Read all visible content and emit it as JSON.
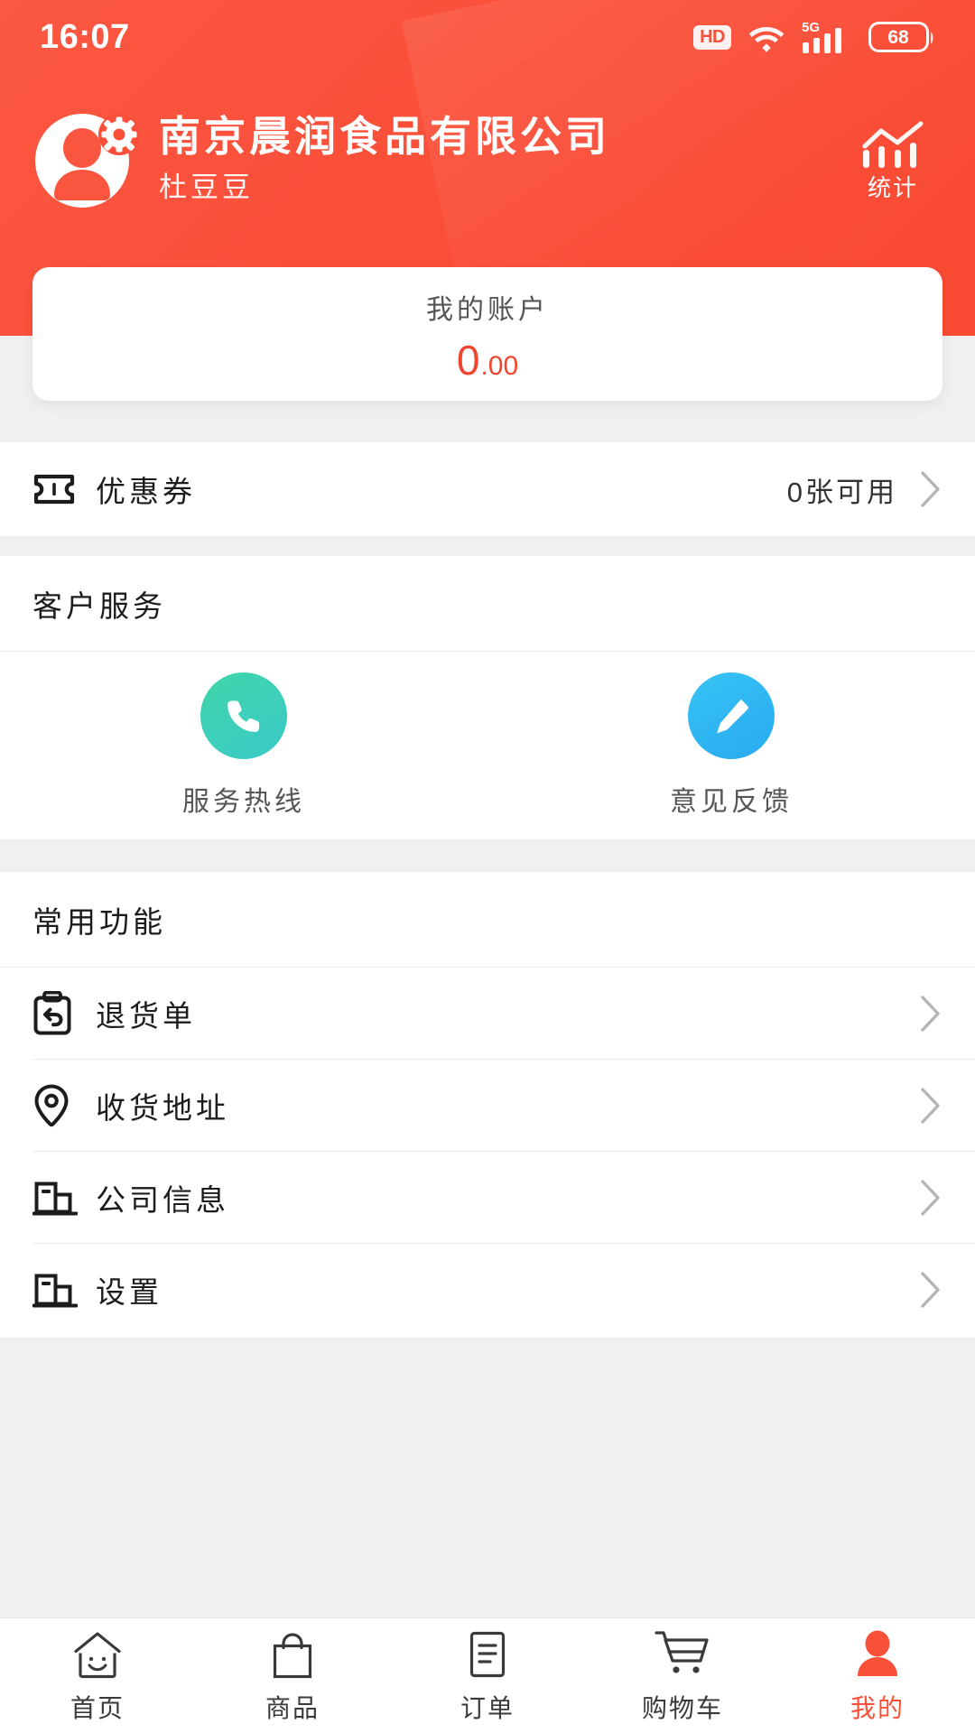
{
  "theme": {
    "brand": "#fa4f39",
    "accent": "#f0462f",
    "page_bg": "#f0f0f0",
    "hotline_icon_color": "#3ed6a8",
    "feedback_icon_color": "#32bcf3",
    "tab_active_color": "#f9503a"
  },
  "status_bar": {
    "time": "16:07",
    "hd_label": "HD",
    "network_label": "5G",
    "battery_level": "68",
    "icons": [
      "hd-badge-icon",
      "wifi-icon",
      "signal-bars-icon",
      "battery-icon"
    ]
  },
  "header": {
    "avatar_icon": "user-avatar-gear-icon",
    "company_name": "南京晨润食品有限公司",
    "user_name": "杜豆豆",
    "stats_button": {
      "label": "统计",
      "icon": "bar-chart-trend-icon"
    }
  },
  "account_card": {
    "label": "我的账户",
    "amount_integer": "0",
    "amount_decimal": ".00"
  },
  "coupon_row": {
    "icon": "ticket-icon",
    "label": "优惠券",
    "value": "0张可用",
    "chevron": "chevron-right-icon"
  },
  "customer_service": {
    "title": "客户服务",
    "items": [
      {
        "label": "服务热线",
        "icon": "phone-icon",
        "color": "green"
      },
      {
        "label": "意见反馈",
        "icon": "pencil-icon",
        "color": "blue"
      }
    ]
  },
  "common_functions": {
    "title": "常用功能",
    "items": [
      {
        "label": "退货单",
        "icon": "return-clipboard-icon",
        "chevron": "chevron-right-icon"
      },
      {
        "label": "收货地址",
        "icon": "location-pin-icon",
        "chevron": "chevron-right-icon"
      },
      {
        "label": "公司信息",
        "icon": "building-icon",
        "chevron": "chevron-right-icon"
      },
      {
        "label": "设置",
        "icon": "building-icon",
        "chevron": "chevron-right-icon"
      }
    ]
  },
  "tab_bar": {
    "active_index": 4,
    "tabs": [
      {
        "label": "首页",
        "icon": "home-smile-icon"
      },
      {
        "label": "商品",
        "icon": "shopping-bag-icon"
      },
      {
        "label": "订单",
        "icon": "order-document-icon"
      },
      {
        "label": "购物车",
        "icon": "shopping-cart-icon"
      },
      {
        "label": "我的",
        "icon": "person-icon"
      }
    ]
  }
}
